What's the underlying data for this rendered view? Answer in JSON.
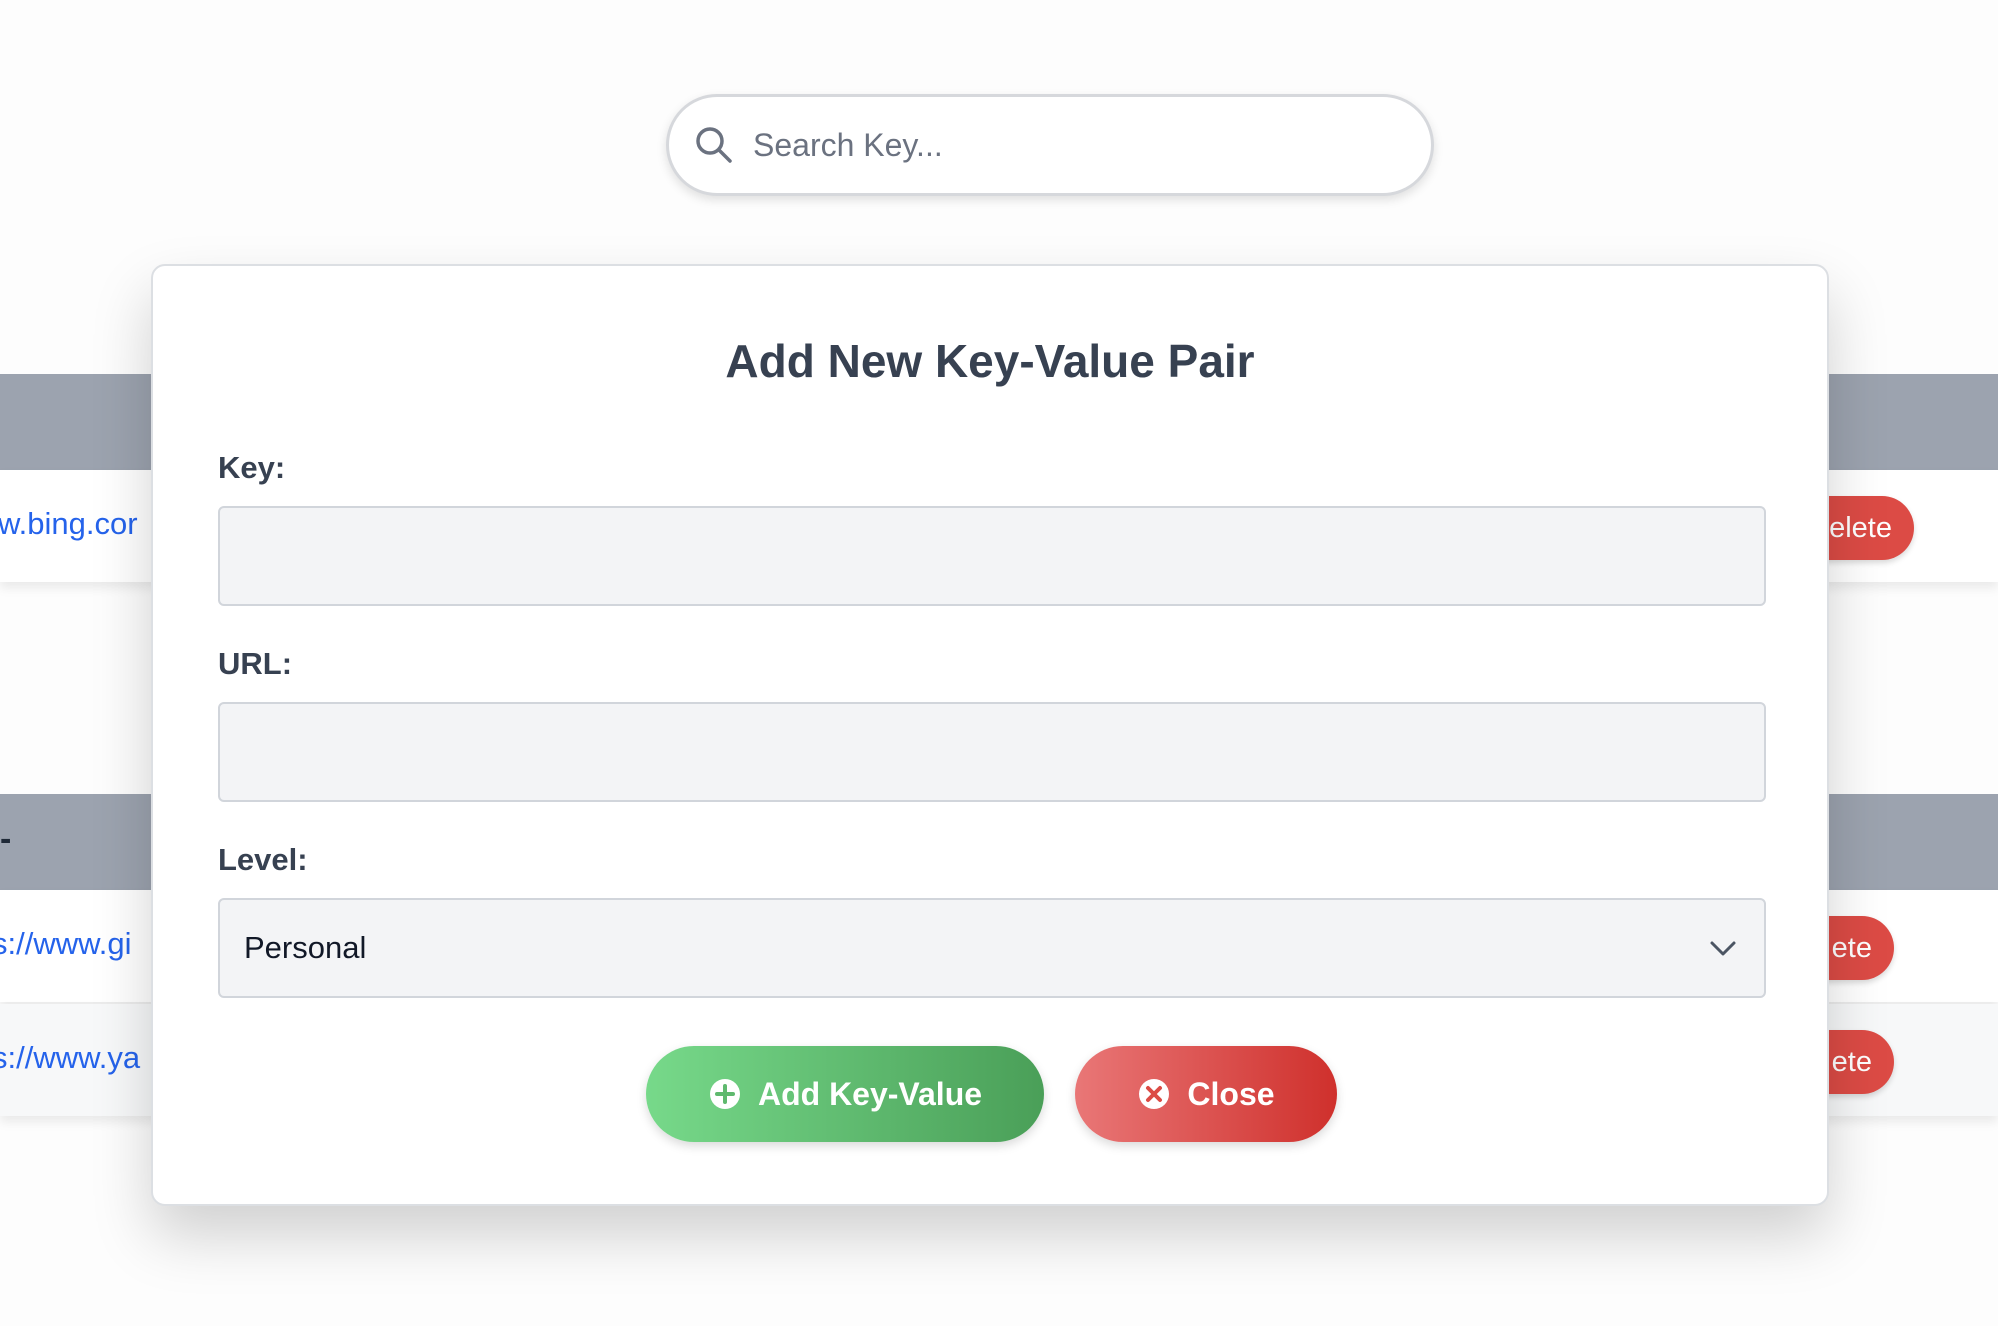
{
  "search": {
    "placeholder": "Search Key...",
    "icon": "search-icon"
  },
  "background": {
    "group1": {
      "row1": {
        "url_fragment": "w.bing.cor",
        "delete_label": "elete"
      }
    },
    "group2": {
      "header_fragment": "-",
      "row1": {
        "url_fragment": "s://www.gi",
        "delete_label": "ete"
      },
      "row2": {
        "url_fragment": "s://www.ya",
        "delete_label": "ete"
      }
    }
  },
  "modal": {
    "title": "Add New Key-Value Pair",
    "fields": {
      "key": {
        "label": "Key:",
        "value": ""
      },
      "url": {
        "label": "URL:",
        "value": ""
      },
      "level": {
        "label": "Level:",
        "selected": "Personal"
      }
    },
    "buttons": {
      "add": {
        "label": "Add Key-Value",
        "icon": "plus-circle-icon"
      },
      "close": {
        "label": "Close",
        "icon": "x-circle-icon"
      }
    }
  },
  "colors": {
    "link": "#2563eb",
    "delete": "#dc4b45",
    "header": "#9ca3af",
    "add_gradient": [
      "#77d98a",
      "#4a9f58"
    ],
    "close_gradient": [
      "#e97777",
      "#cf302c"
    ]
  }
}
